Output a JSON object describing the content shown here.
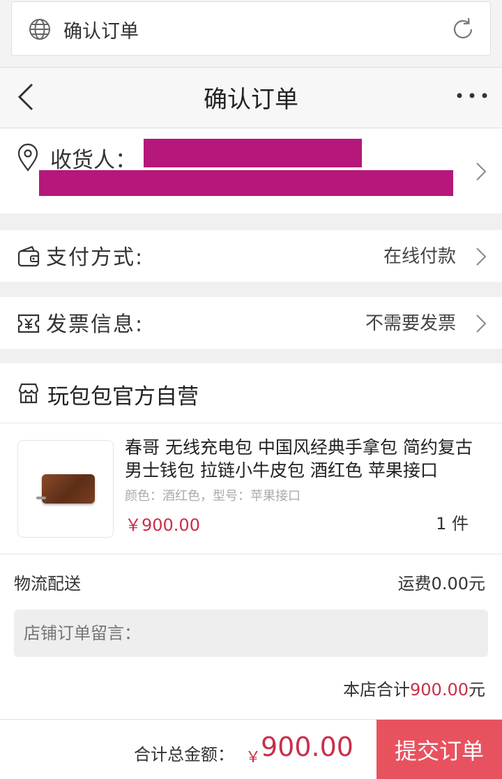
{
  "browser": {
    "url_title": "确认订单"
  },
  "header": {
    "title": "确认订单"
  },
  "address": {
    "label": "收货人："
  },
  "payment": {
    "label": "支付方式:",
    "value": "在线付款"
  },
  "invoice": {
    "label": "发票信息:",
    "value": "不需要发票"
  },
  "shop": {
    "name": "玩包包官方自营",
    "product": {
      "title": "春哥 无线充电包 中国风经典手拿包 简约复古男士钱包 拉链小牛皮包 酒红色 苹果接口",
      "spec": "颜色：酒红色，型号：苹果接口",
      "price": "￥900.00",
      "quantity": "1 件"
    },
    "shipping": {
      "label": "物流配送",
      "fee": "运费0.00元"
    },
    "note_placeholder": "店铺订单留言：",
    "subtotal": {
      "prefix": "本店合计",
      "amount": "900.00",
      "suffix": "元"
    }
  },
  "footer": {
    "total_label": "合计总金额：",
    "currency": "￥",
    "total_amount": "900.00",
    "submit_label": "提交订单"
  },
  "colors": {
    "accent": "#c8304a",
    "submit_bg": "#e8525f",
    "redaction": "#b5177a"
  }
}
